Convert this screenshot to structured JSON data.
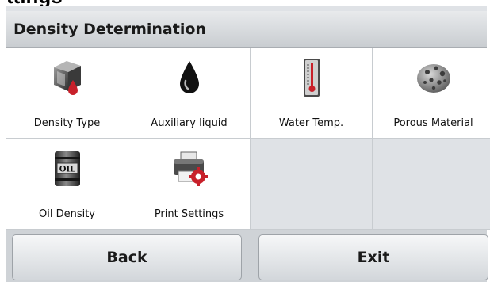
{
  "cut_heading": "ttings",
  "title": "Density Determination",
  "tiles": [
    {
      "label": "Density Type",
      "icon": "density-type-icon"
    },
    {
      "label": "Auxiliary liquid",
      "icon": "liquid-drop-icon"
    },
    {
      "label": "Water Temp.",
      "icon": "thermometer-icon"
    },
    {
      "label": "Porous Material",
      "icon": "porous-material-icon"
    },
    {
      "label": "Oil Density",
      "icon": "oil-barrel-icon",
      "icon_text": "OIL"
    },
    {
      "label": "Print Settings",
      "icon": "printer-settings-icon"
    }
  ],
  "buttons": {
    "back": "Back",
    "exit": "Exit"
  },
  "colors": {
    "accent_red": "#c8202a",
    "title_bar": "#d6d9dc",
    "background": "#dfe2e6"
  }
}
